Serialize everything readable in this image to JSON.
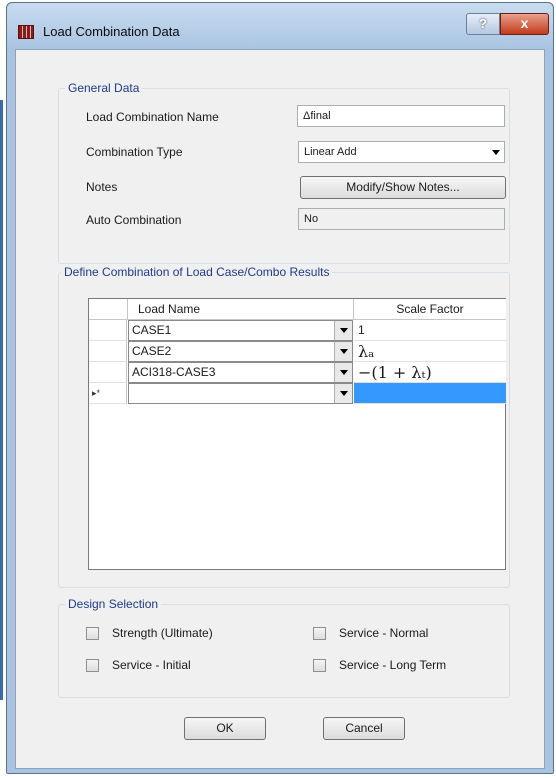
{
  "window": {
    "title": "Load Combination Data",
    "help_glyph": "?",
    "close_glyph": "x"
  },
  "general": {
    "group_label": "General Data",
    "name_label": "Load Combination Name",
    "name_value": "Δfinal",
    "type_label": "Combination Type",
    "type_value": "Linear Add",
    "notes_label": "Notes",
    "notes_button": "Modify/Show Notes...",
    "auto_label": "Auto Combination",
    "auto_value": "No"
  },
  "define": {
    "group_label": "Define Combination of Load Case/Combo Results",
    "columns": [
      "Load Name",
      "Scale Factor"
    ],
    "new_row_marker": "▸*",
    "rows": [
      {
        "load_name": "CASE1",
        "scale_factor": "1"
      },
      {
        "load_name": "CASE2",
        "scale_factor": "λₐ"
      },
      {
        "load_name": "ACI318-CASE3",
        "scale_factor": "−(1 + λₜ)"
      },
      {
        "load_name": "",
        "scale_factor": ""
      }
    ]
  },
  "design": {
    "group_label": "Design Selection",
    "options": [
      {
        "label": "Strength (Ultimate)",
        "checked": false
      },
      {
        "label": "Service - Normal",
        "checked": false
      },
      {
        "label": "Service - Initial",
        "checked": false
      },
      {
        "label": "Service - Long Term",
        "checked": false
      }
    ]
  },
  "buttons": {
    "ok": "OK",
    "cancel": "Cancel"
  },
  "colors": {
    "selection": "#3399ff",
    "group_label": "#1e3a8c",
    "close_button": "#c43b1c"
  }
}
